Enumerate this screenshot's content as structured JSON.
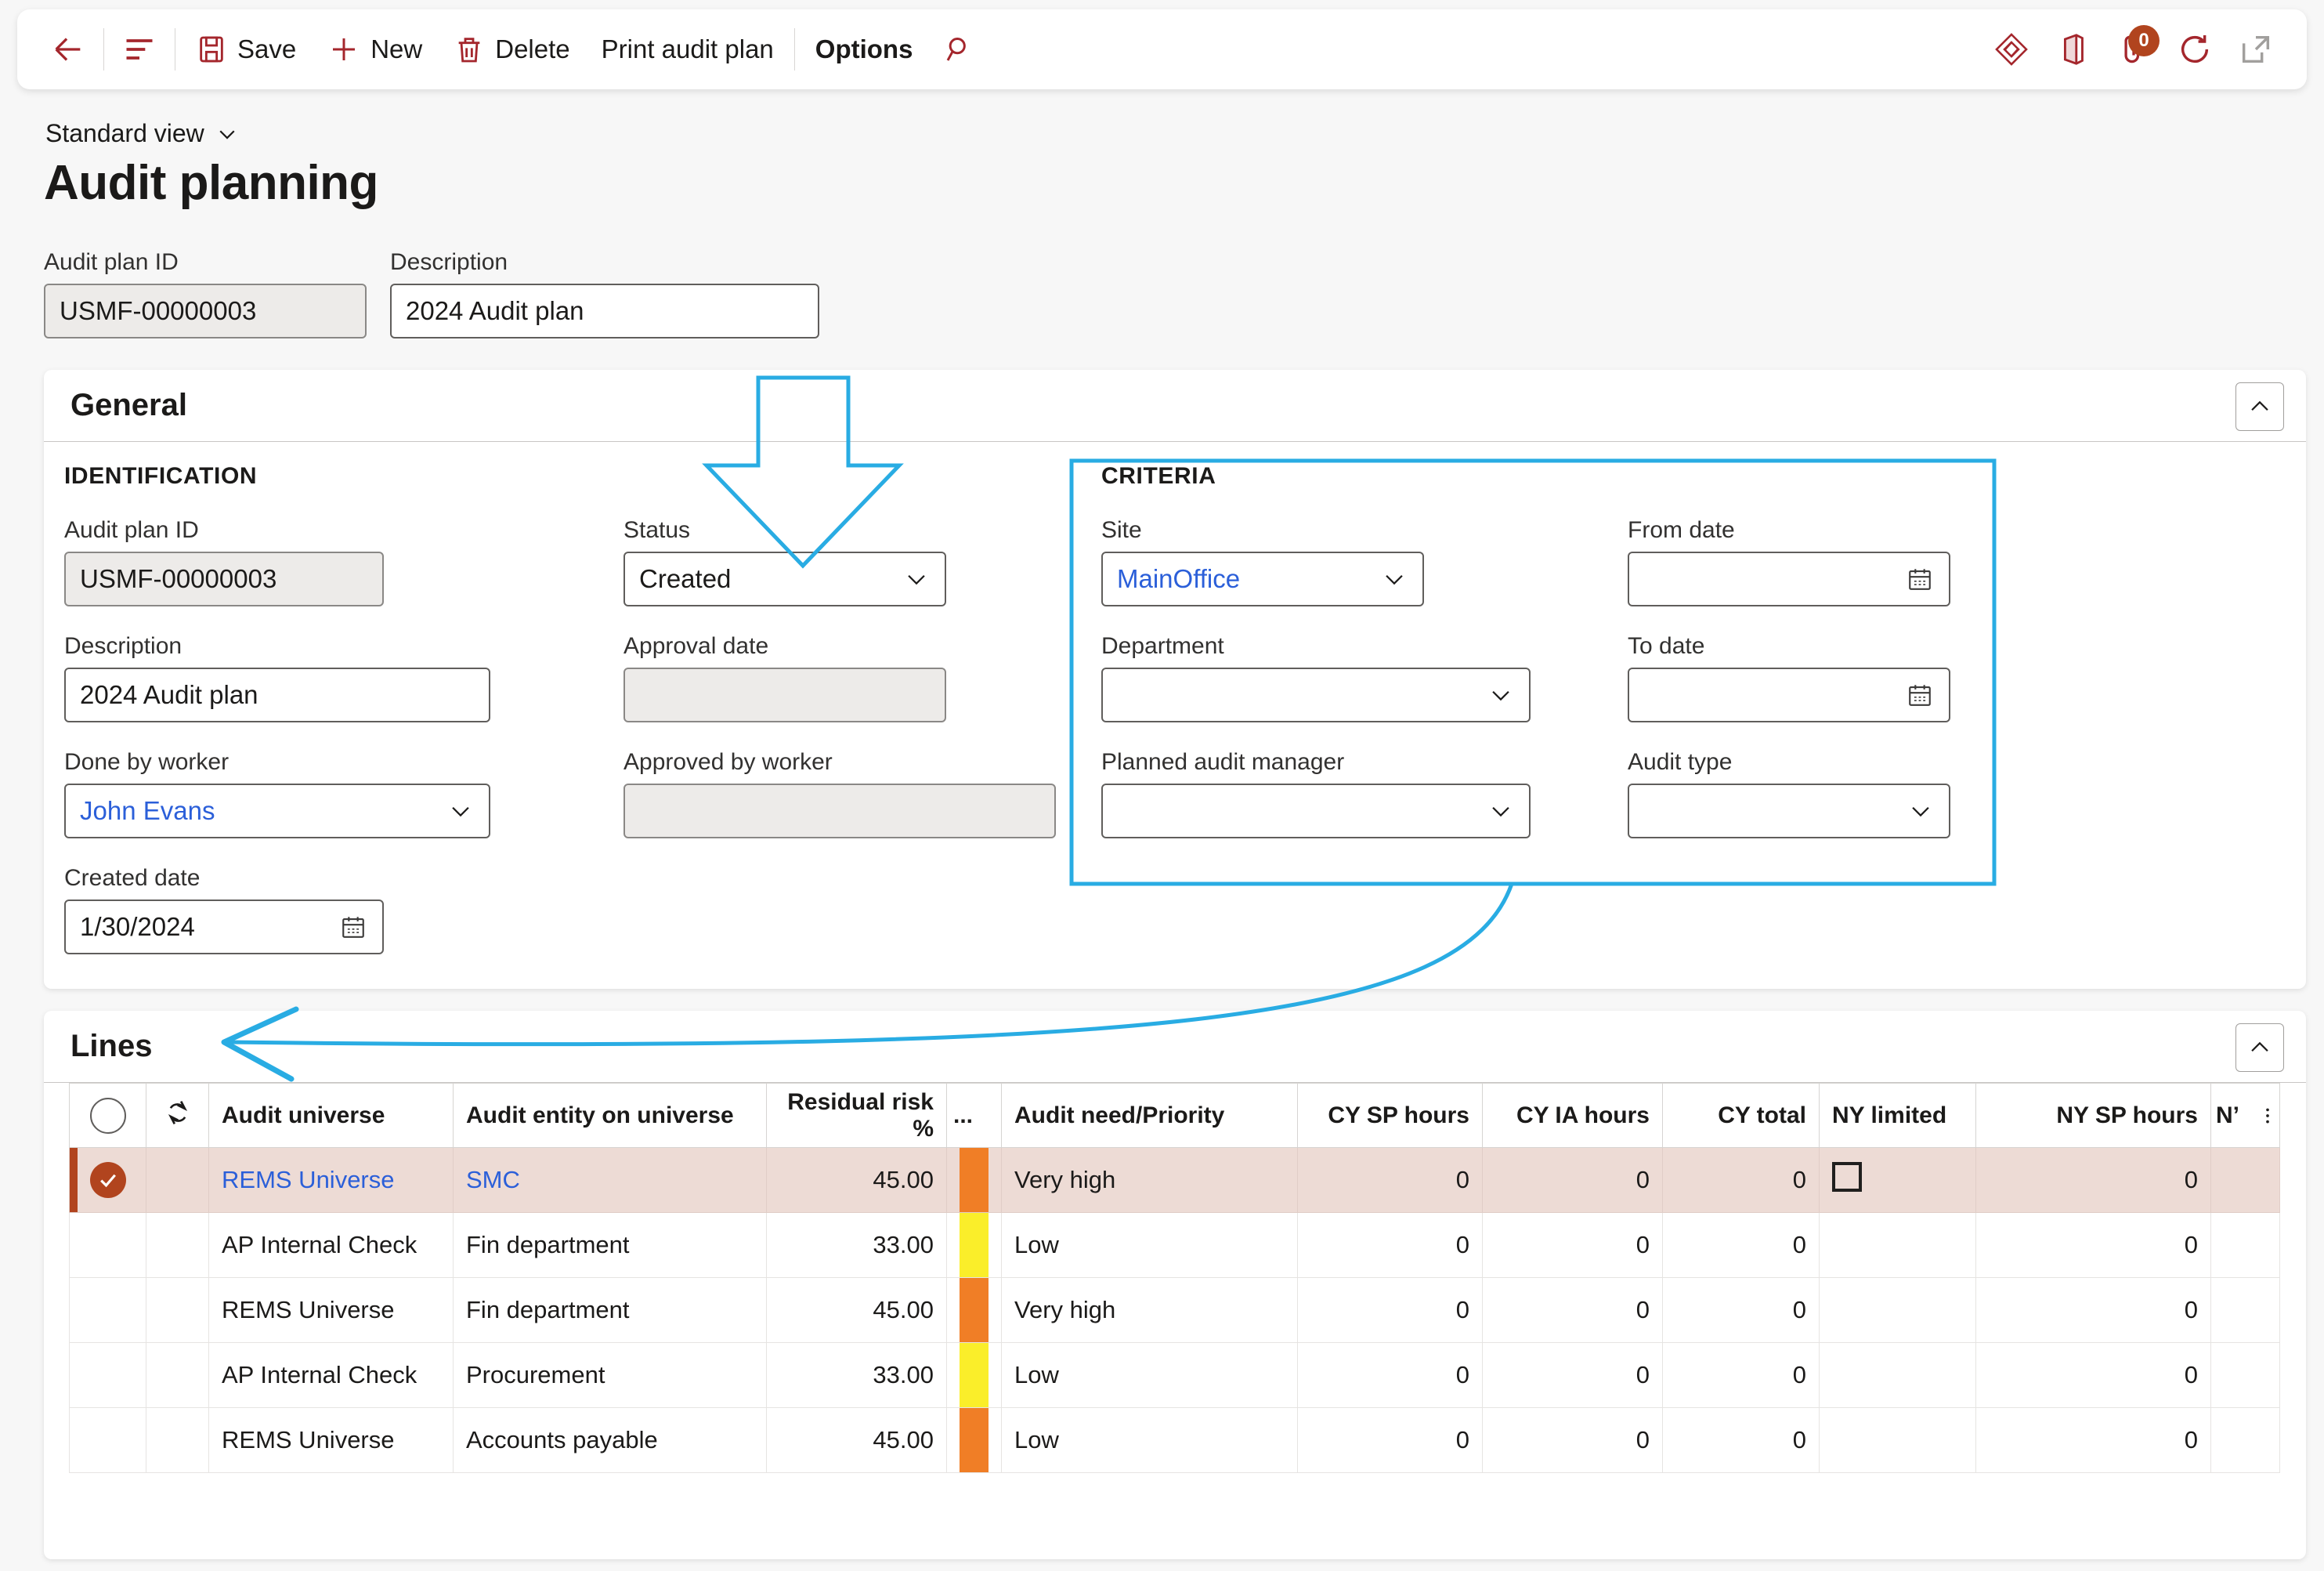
{
  "toolbar": {
    "back_label": "back-arrow",
    "show_list_label": "show-list",
    "save_label": "Save",
    "new_label": "New",
    "delete_label": "Delete",
    "print_label": "Print audit plan",
    "options_label": "Options",
    "search_label": "search",
    "attachments_badge": "0"
  },
  "header": {
    "view_name": "Standard view",
    "page_title": "Audit planning"
  },
  "quick_fields": {
    "audit_plan_id_label": "Audit plan ID",
    "audit_plan_id_value": "USMF-00000003",
    "description_label": "Description",
    "description_value": "2024 Audit plan"
  },
  "general": {
    "section_title": "General",
    "identification": {
      "group_title": "IDENTIFICATION",
      "audit_plan_id_label": "Audit plan ID",
      "audit_plan_id_value": "USMF-00000003",
      "description_label": "Description",
      "description_value": "2024 Audit plan",
      "done_by_worker_label": "Done by worker",
      "done_by_worker_value": "John Evans",
      "created_date_label": "Created date",
      "created_date_value": "1/30/2024"
    },
    "status_column": {
      "status_label": "Status",
      "status_value": "Created",
      "approval_date_label": "Approval date",
      "approval_date_value": "",
      "approved_by_worker_label": "Approved by worker",
      "approved_by_worker_value": ""
    },
    "criteria": {
      "group_title": "CRITERIA",
      "site_label": "Site",
      "site_value": "MainOffice",
      "department_label": "Department",
      "department_value": "",
      "planned_audit_manager_label": "Planned audit manager",
      "planned_audit_manager_value": "",
      "from_date_label": "From date",
      "from_date_value": "",
      "to_date_label": "To date",
      "to_date_value": "",
      "audit_type_label": "Audit type",
      "audit_type_value": ""
    }
  },
  "lines": {
    "section_title": "Lines",
    "columns": [
      "",
      "",
      "Audit universe",
      "Audit entity on universe",
      "Residual risk %",
      "...",
      "Audit need/Priority",
      "CY SP hours",
      "CY IA hours",
      "CY total",
      "NY limited",
      "NY SP hours",
      "N’"
    ],
    "rows": [
      {
        "selected": true,
        "audit_universe": "REMS Universe",
        "audit_entity": "SMC",
        "residual_risk": "45.00",
        "risk_color": "#F07E26",
        "priority": "Very high",
        "cy_sp_hours": "0",
        "cy_ia_hours": "0",
        "cy_total": "0",
        "ny_limited": false,
        "ny_sp_hours": "0"
      },
      {
        "selected": false,
        "audit_universe": "AP Internal Check",
        "audit_entity": "Fin department",
        "residual_risk": "33.00",
        "risk_color": "#FAEE2A",
        "priority": "Low",
        "cy_sp_hours": "0",
        "cy_ia_hours": "0",
        "cy_total": "0",
        "ny_limited": null,
        "ny_sp_hours": "0"
      },
      {
        "selected": false,
        "audit_universe": "REMS Universe",
        "audit_entity": "Fin department",
        "residual_risk": "45.00",
        "risk_color": "#F07E26",
        "priority": "Very high",
        "cy_sp_hours": "0",
        "cy_ia_hours": "0",
        "cy_total": "0",
        "ny_limited": null,
        "ny_sp_hours": "0"
      },
      {
        "selected": false,
        "audit_universe": "AP Internal Check",
        "audit_entity": "Procurement",
        "residual_risk": "33.00",
        "risk_color": "#FAEE2A",
        "priority": "Low",
        "cy_sp_hours": "0",
        "cy_ia_hours": "0",
        "cy_total": "0",
        "ny_limited": null,
        "ny_sp_hours": "0"
      },
      {
        "selected": false,
        "audit_universe": "REMS Universe",
        "audit_entity": "Accounts payable",
        "residual_risk": "45.00",
        "risk_color": "#F07E26",
        "priority": "Low",
        "cy_sp_hours": "0",
        "cy_ia_hours": "0",
        "cy_total": "0",
        "ny_limited": null,
        "ny_sp_hours": "0"
      }
    ]
  },
  "colors": {
    "accent_red": "#a4262c",
    "selection_row": "#eddbd5",
    "selection_bar": "#b1441e",
    "annotation_blue": "#29ace3",
    "link_blue": "#2b5fd9",
    "risk_high": "#F07E26",
    "risk_low": "#FAEE2A"
  },
  "annotations": {
    "down_arrow": "blue-down-arrow-to-status",
    "criteria_outline": "blue-rectangle-around-criteria",
    "curved_arrow": "blue-curved-arrow-criteria-to-lines"
  }
}
